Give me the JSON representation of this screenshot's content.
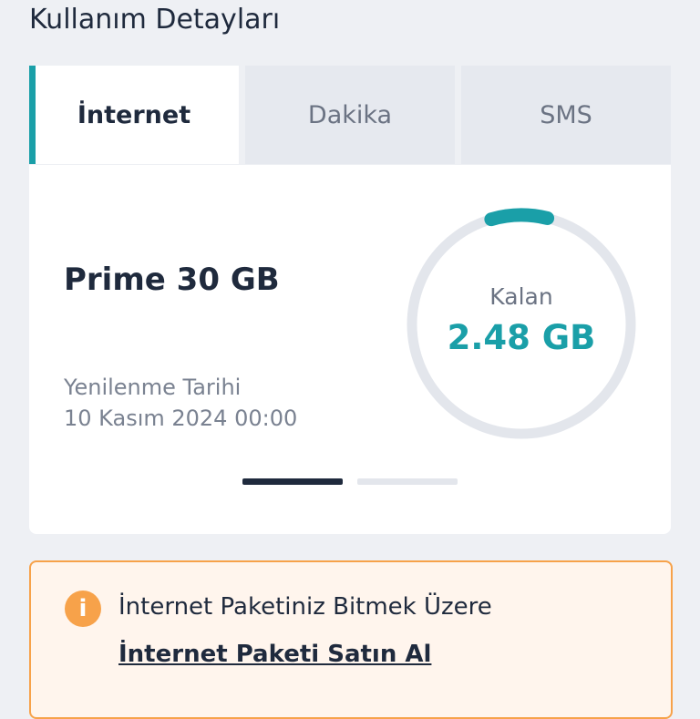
{
  "page": {
    "title": "Kullanım Detayları"
  },
  "tabs": [
    {
      "label": "İnternet",
      "active": true
    },
    {
      "label": "Dakika",
      "active": false
    },
    {
      "label": "SMS",
      "active": false
    }
  ],
  "usage_card": {
    "plan_name": "Prime 30 GB",
    "renewal_label": "Yenilenme Tarihi",
    "renewal_date": "10 Kasım 2024 00:00",
    "remaining_label": "Kalan",
    "remaining_value": "2.48 GB",
    "remaining_fraction": 0.0827,
    "pager": {
      "total": 2,
      "active_index": 0
    }
  },
  "alert": {
    "icon": "info-icon",
    "icon_glyph": "i",
    "message": "İnternet Paketiniz Bitmek Üzere",
    "link_label": "İnternet Paketi Satın Al"
  },
  "colors": {
    "accent": "#1a9fa8",
    "ring_track": "#e3e6ec",
    "warning": "#f7a24a",
    "warning_bg": "#fff5ed"
  }
}
